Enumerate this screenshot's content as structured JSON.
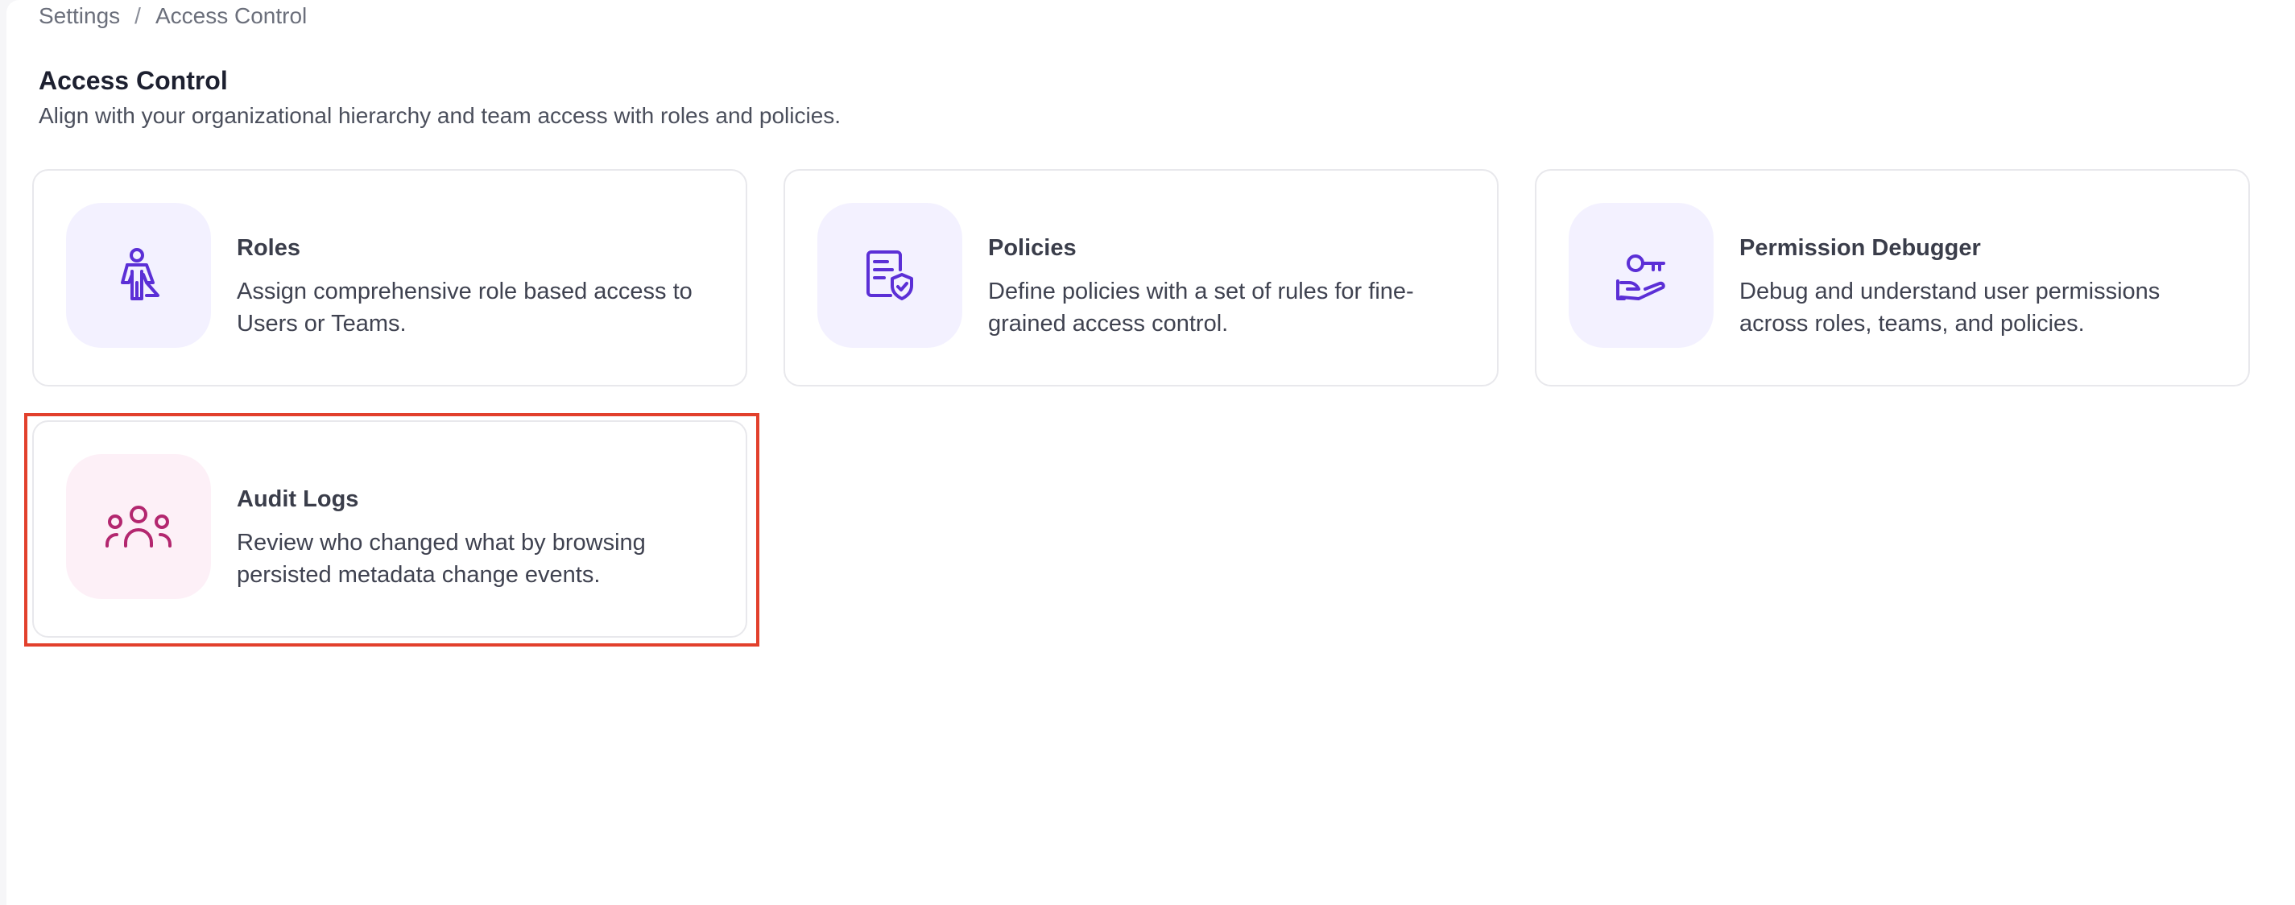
{
  "breadcrumb": {
    "items": [
      "Settings",
      "Access Control"
    ],
    "separator": "/"
  },
  "page": {
    "title": "Access Control",
    "subtitle": "Align with your organizational hierarchy and team access with roles and policies."
  },
  "cards": [
    {
      "title": "Roles",
      "description": "Assign comprehensive role based access to Users or Teams.",
      "icon": "role-person-icon",
      "icon_color": "#5b2fd6"
    },
    {
      "title": "Policies",
      "description": "Define policies with a set of rules for fine-grained access control.",
      "icon": "policy-document-shield-icon",
      "icon_color": "#5b2fd6"
    },
    {
      "title": "Permission Debugger",
      "description": "Debug and understand user permissions across roles, teams, and policies.",
      "icon": "key-hand-icon",
      "icon_color": "#5b2fd6"
    },
    {
      "title": "Audit Logs",
      "description": "Review who changed what by browsing persisted metadata change events.",
      "icon": "users-group-icon",
      "icon_color": "#b3276f"
    }
  ],
  "colors": {
    "accent_purple": "#5b2fd6",
    "accent_pink": "#b3276f",
    "highlight": "#e2402c"
  }
}
